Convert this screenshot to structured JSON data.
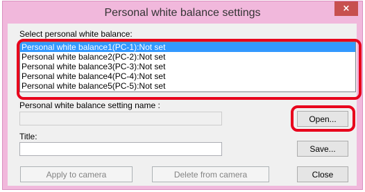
{
  "window": {
    "title": "Personal white balance settings",
    "close_glyph": "×"
  },
  "select_label": "Select personal white balance:",
  "list_items": [
    "Personal white balance1(PC-1):Not set",
    "Personal white balance2(PC-2):Not set",
    "Personal white balance3(PC-3):Not set",
    "Personal white balance4(PC-4):Not set",
    "Personal white balance5(PC-5):Not set"
  ],
  "setting_name_label": "Personal white balance setting name :",
  "setting_name_value": "",
  "title_label": "Title:",
  "title_value": "",
  "buttons": {
    "open": "Open...",
    "save": "Save...",
    "apply": "Apply to camera",
    "delete": "Delete from camera",
    "close": "Close"
  },
  "colors": {
    "titlebar": "#f1b8dc",
    "selection": "#3399ff",
    "highlight_outline": "#e8001c",
    "close_button": "#c7504f"
  }
}
